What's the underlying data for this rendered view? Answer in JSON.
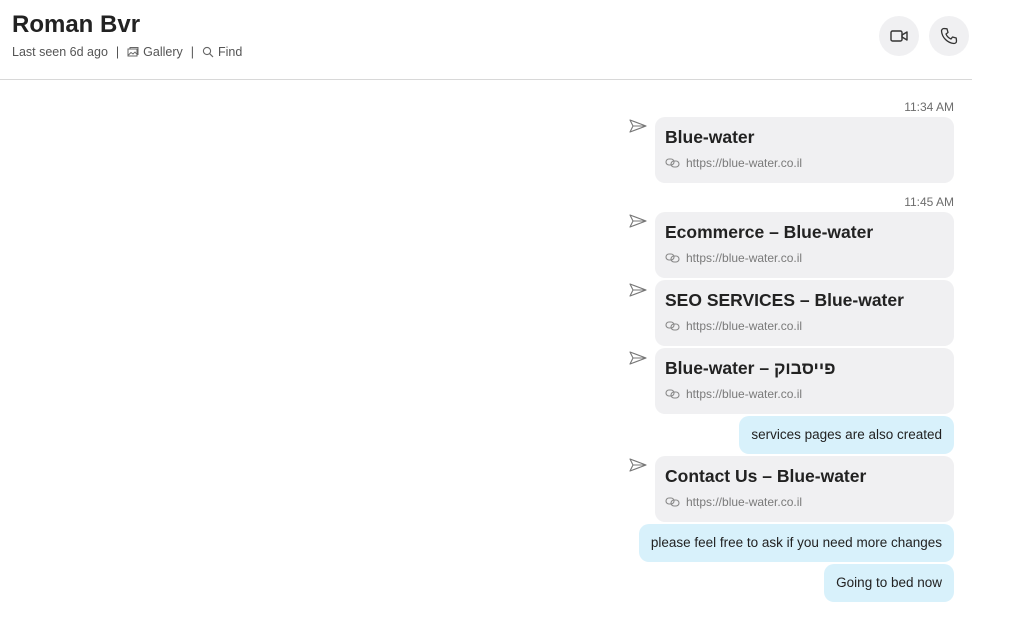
{
  "header": {
    "title": "Roman Bvr",
    "last_seen": "Last seen 6d ago",
    "separator": "|",
    "gallery_label": "Gallery",
    "find_label": "Find"
  },
  "messages": {
    "ts1": "11:34 AM",
    "ts2": "11:45 AM",
    "cards": [
      {
        "title": "Blue-water",
        "url": "https://blue-water.co.il"
      },
      {
        "title": "Ecommerce – Blue-water",
        "url": "https://blue-water.co.il"
      },
      {
        "title": "SEO SERVICES – Blue-water",
        "url": "https://blue-water.co.il"
      },
      {
        "title": "Blue-water – פייסבוק",
        "url": "https://blue-water.co.il"
      },
      {
        "title": "Contact Us – Blue-water",
        "url": "https://blue-water.co.il"
      }
    ],
    "bubbles": [
      "services pages are also created",
      "please feel free to ask if you need more changes",
      "Going to bed now"
    ]
  },
  "colors": {
    "card_bg": "#f0f0f2",
    "bubble_bg": "#d8f1fb"
  }
}
